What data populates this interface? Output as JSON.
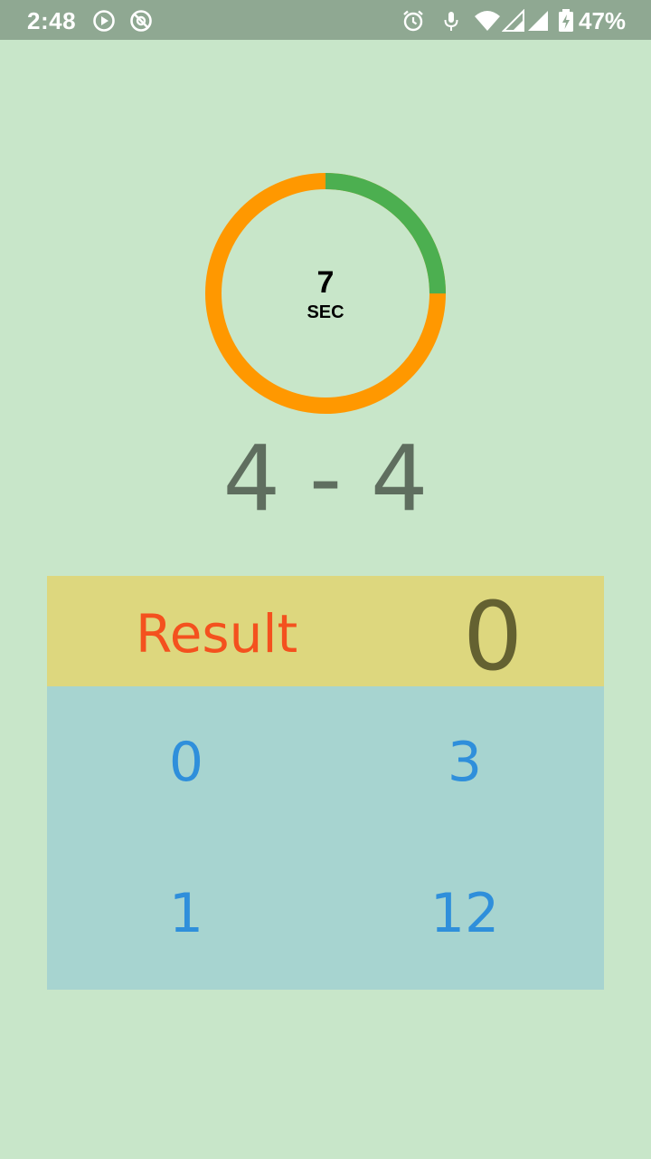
{
  "status_bar": {
    "time": "2:48",
    "battery_percent": "47%",
    "icons": [
      "play-circle-icon",
      "no-disturb-icon",
      "alarm-icon",
      "mic-icon",
      "wifi-icon",
      "signal-icon",
      "signal-icon",
      "battery-charging-icon"
    ]
  },
  "timer": {
    "value": "7",
    "unit": "SEC",
    "remaining_fraction": 0.25,
    "remaining_color": "#4caf50",
    "elapsed_color": "#ff9800"
  },
  "question": {
    "text": "4 - 4"
  },
  "result": {
    "label": "Result",
    "value": "0"
  },
  "options": [
    "0",
    "3",
    "1",
    "12"
  ],
  "colors": {
    "background": "#c8e6c9",
    "result_bar": "#ddd77e",
    "options_panel": "#a7d4d0",
    "option_text": "#2f8fdb",
    "result_label": "#f4511e"
  }
}
